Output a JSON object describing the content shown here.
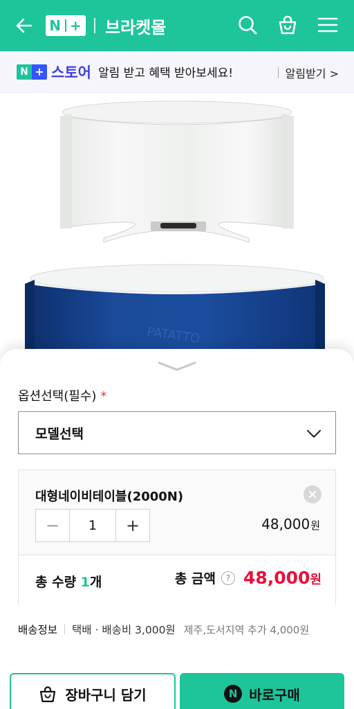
{
  "header": {
    "logo_n": "N",
    "logo_plus": "+",
    "shop_name": "브라켓몰",
    "icons": [
      "back-arrow-icon",
      "search-icon",
      "shopping-bag-icon",
      "menu-icon"
    ],
    "bg_color": "#1ec49a"
  },
  "banner": {
    "badge_n": "N",
    "badge_plus": "+",
    "store_label": "스토어",
    "message": "알림 받고 혜택 받아보세요!",
    "alarm_link": "알림받기 >"
  },
  "product_image": {
    "brand_text": "PATATTO",
    "icon": "product-photo"
  },
  "option": {
    "label": "옵션선택(필수)",
    "required_mark": "*",
    "select_value": "모델선택"
  },
  "selected_item": {
    "name": "대형네이비테이블(2000N)",
    "remove_icon": "close-icon",
    "quantity": "1",
    "minus": "−",
    "plus": "+",
    "price": "48,000",
    "price_unit": "원"
  },
  "totals": {
    "qty_prefix": "총 수량 ",
    "qty_count": "1",
    "qty_suffix": "개",
    "price_label": "총 금액",
    "help": "?",
    "amount": "48,000",
    "amount_unit": "원",
    "accent_color": "#e8113a"
  },
  "delivery": {
    "label": "배송정보",
    "method": "택배 · 배송비 3,000원",
    "extra": "제주,도서지역 추가 4,000원"
  },
  "actions": {
    "cart_label": "장바구니 담기",
    "buy_n": "N",
    "buy_label": "바로구매"
  }
}
